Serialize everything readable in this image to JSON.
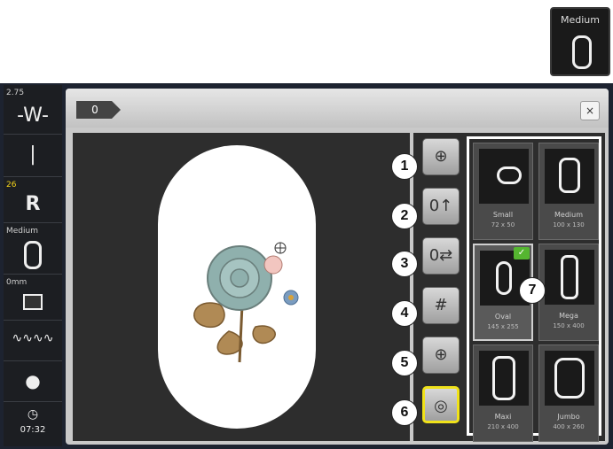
{
  "top_icon": {
    "label": "Medium",
    "icon": "medium-hoop-icon"
  },
  "sidebar": {
    "value_top": "2.75",
    "value_yellow": "26",
    "hoop_label": "Medium",
    "offset_label": "0mm",
    "time": "07:32"
  },
  "window": {
    "tab_label": "0",
    "close_label": "×"
  },
  "buttons": [
    {
      "callout": "1",
      "icon": "hoop-center-icon"
    },
    {
      "callout": "2",
      "icon": "hoop-move-up-icon"
    },
    {
      "callout": "3",
      "icon": "hoop-move-icon"
    },
    {
      "callout": "4",
      "icon": "grid-icon"
    },
    {
      "callout": "5",
      "icon": "crosshair-icon"
    },
    {
      "callout": "6",
      "icon": "template-icon"
    }
  ],
  "hoops": [
    {
      "name": "Small",
      "dims": "72 x 50"
    },
    {
      "name": "Medium",
      "dims": "100 x 130"
    },
    {
      "name": "Oval",
      "dims": "145 x 255",
      "selected": true
    },
    {
      "name": "Mega",
      "dims": "150 x 400"
    },
    {
      "name": "Maxi",
      "dims": "210 x 400"
    },
    {
      "name": "Jumbo",
      "dims": "400 x 260"
    }
  ],
  "callout_7": "7",
  "colors": {
    "selected_border": "#f0e21a",
    "check_green": "#55b630"
  }
}
